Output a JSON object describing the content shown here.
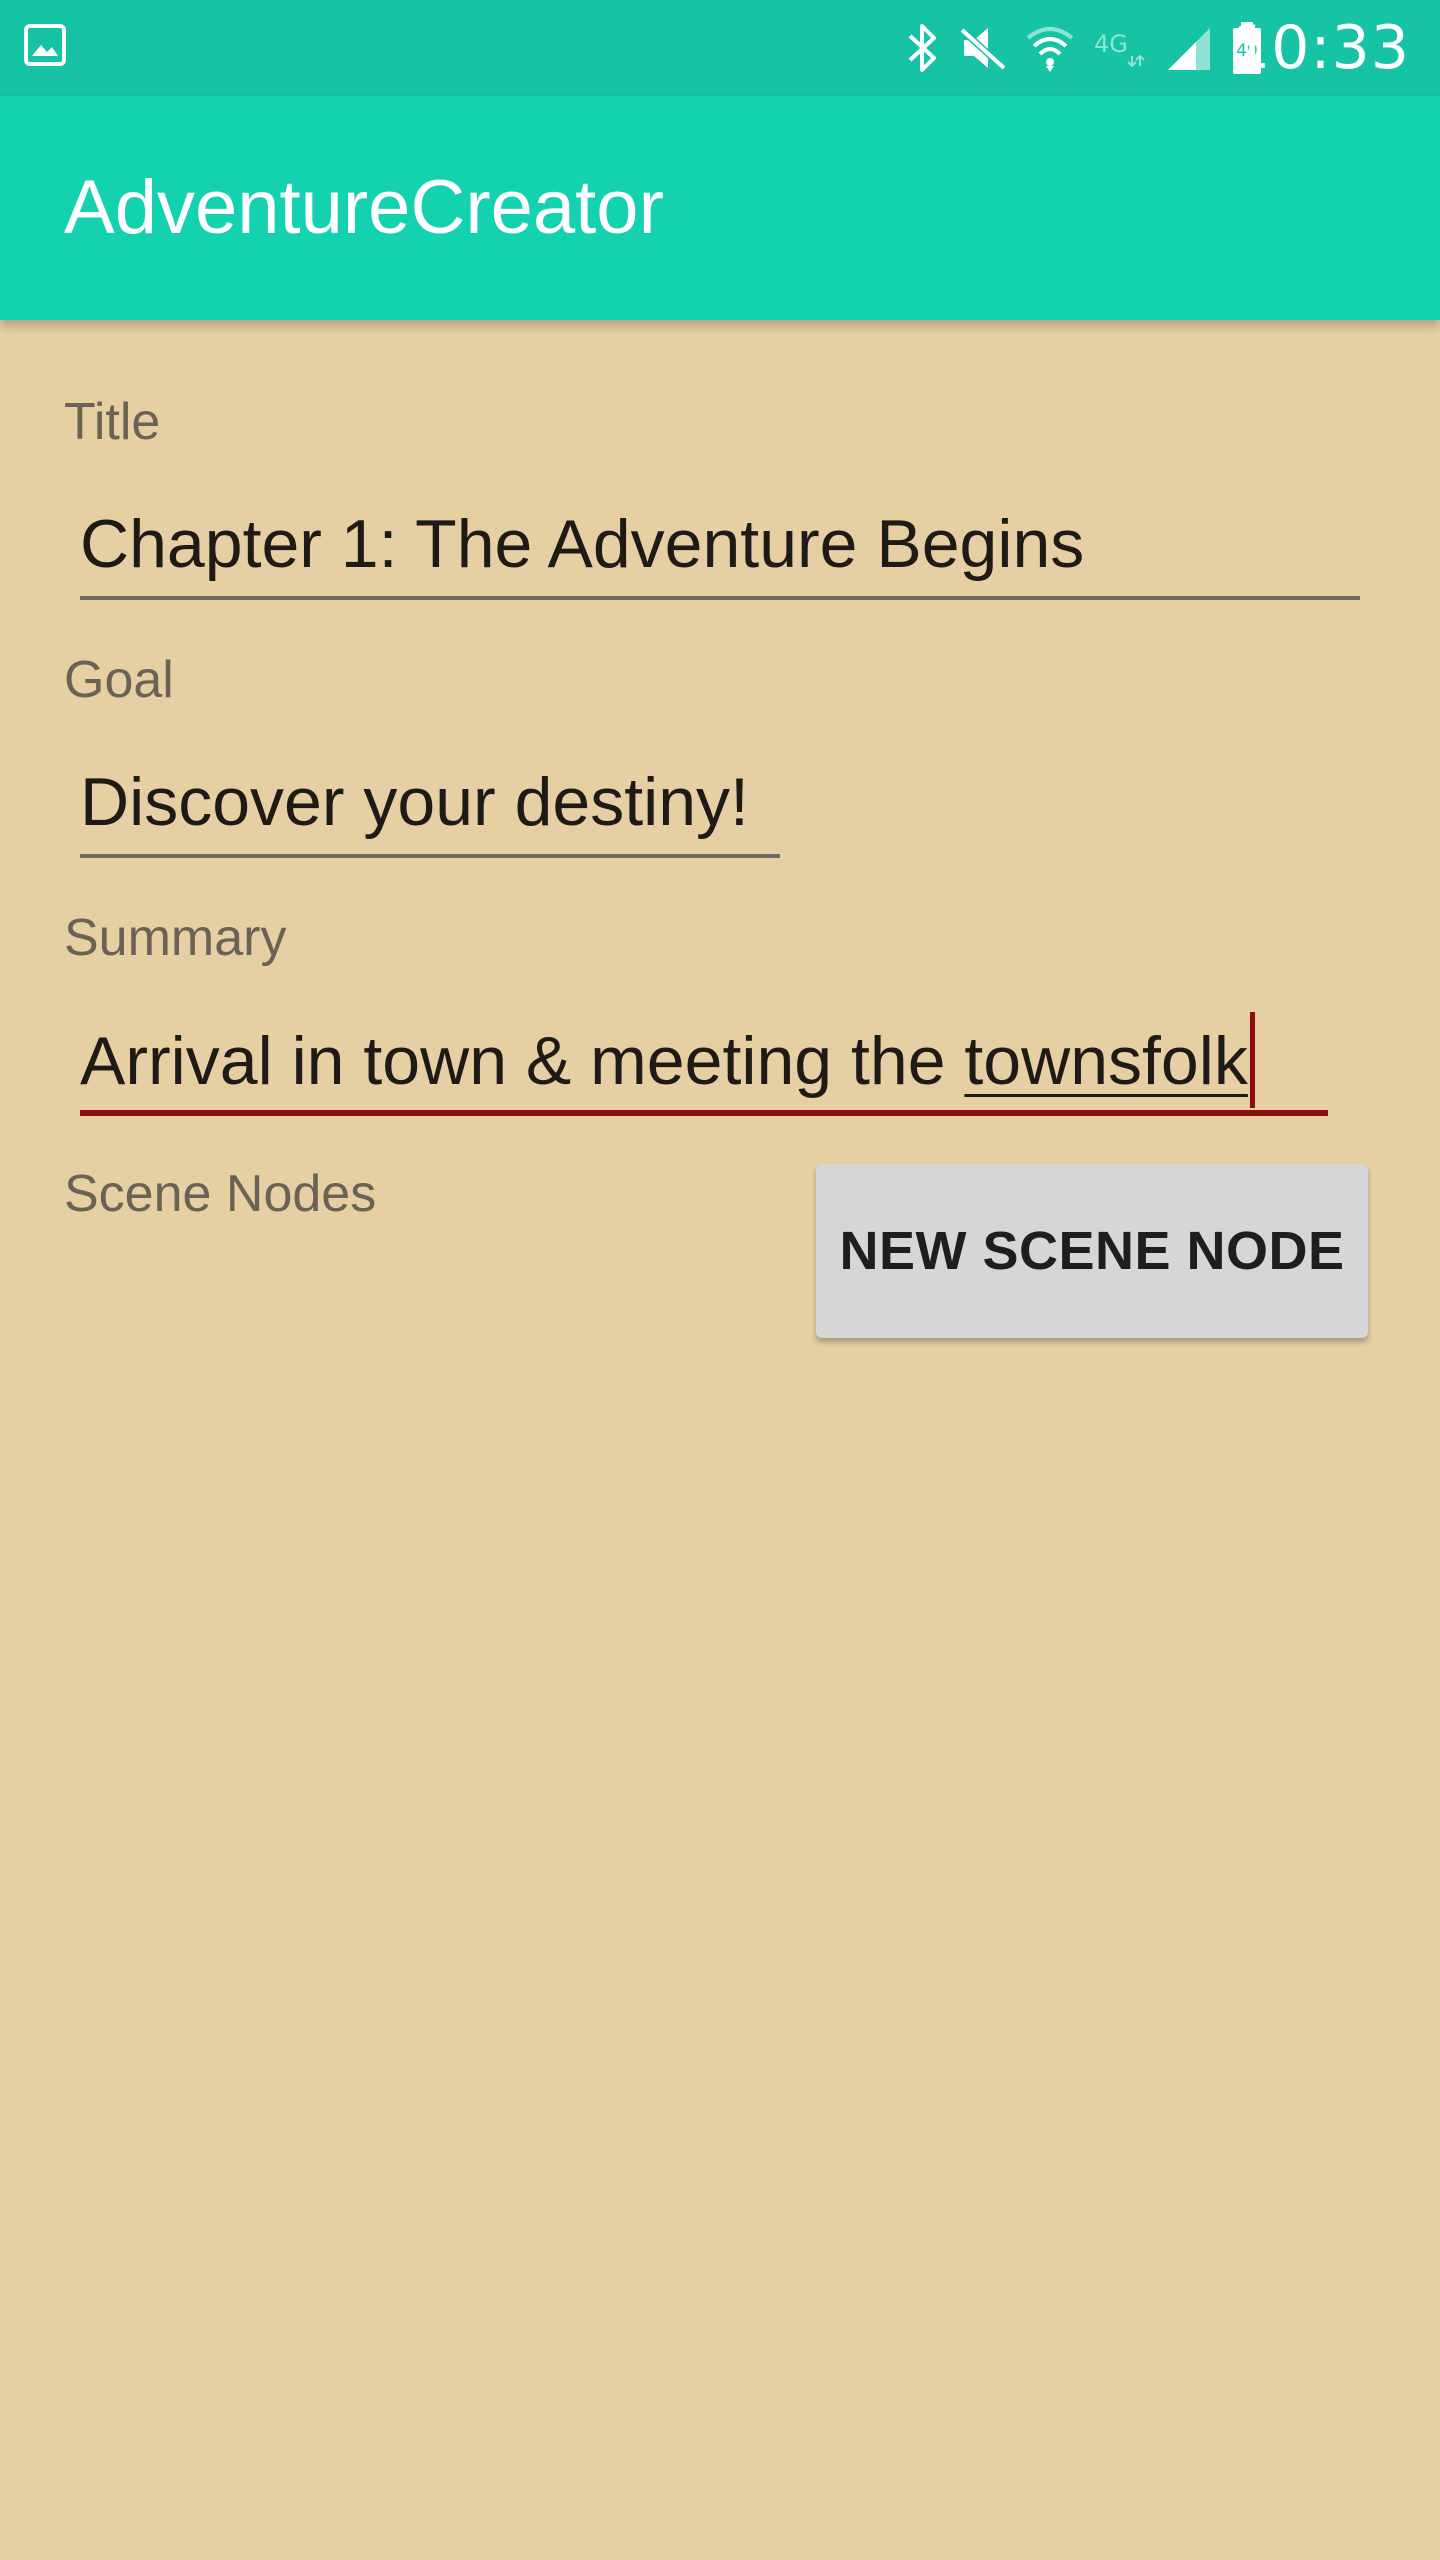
{
  "status_bar": {
    "time": "10:33",
    "battery_level": "49",
    "network_label": "4G",
    "icons": [
      "gallery-icon",
      "bluetooth-icon",
      "mute-icon",
      "wifi-icon",
      "lte-icon",
      "signal-icon",
      "battery-icon"
    ],
    "background_color": "#17C3A5"
  },
  "app_bar": {
    "title": "AdventureCreator",
    "background_color": "#14D2B0"
  },
  "form": {
    "title": {
      "label": "Title",
      "value": "Chapter 1: The Adventure Begins"
    },
    "goal": {
      "label": "Goal",
      "value": "Discover your destiny!"
    },
    "summary": {
      "label": "Summary",
      "value_committed": "Arrival in town & meeting the ",
      "value_composing": "townsfolk",
      "focused": true
    },
    "scene_nodes": {
      "label": "Scene Nodes",
      "new_button_label": "NEW SCENE NODE"
    }
  },
  "colors": {
    "page_background": "#E7CFA4",
    "accent": "#8B0F0F",
    "label_text": "#6B6256",
    "button_background": "#D6D6D6"
  }
}
